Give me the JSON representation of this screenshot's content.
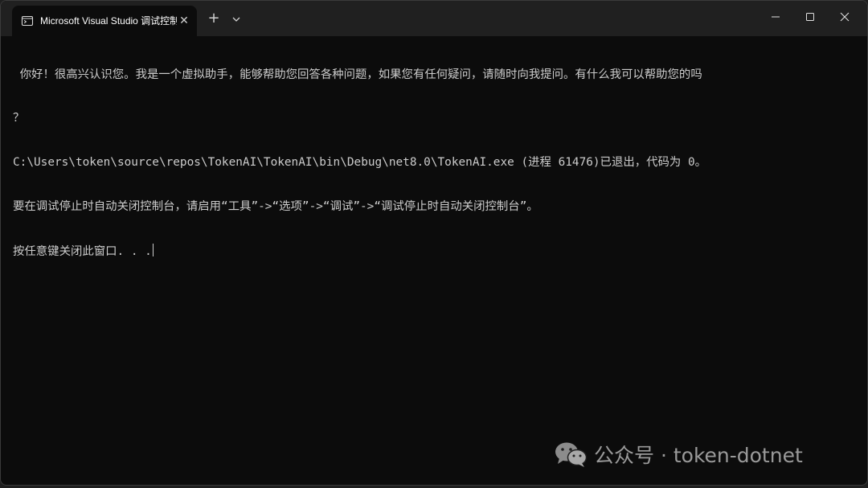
{
  "window": {
    "tab_title": "Microsoft Visual Studio 调试控制台",
    "tab_close": "✕",
    "new_tab": "+",
    "icons": {
      "tab": "terminal-icon",
      "dropdown": "chevron-down-icon",
      "minimize": "minimize-icon",
      "maximize": "maximize-icon",
      "close": "close-icon"
    }
  },
  "terminal": {
    "lines": [
      " 你好！很高兴认识您。我是一个虚拟助手，能够帮助您回答各种问题，如果您有任何疑问，请随时向我提问。有什么我可以帮助您的吗",
      "？",
      "C:\\Users\\token\\source\\repos\\TokenAI\\TokenAI\\bin\\Debug\\net8.0\\TokenAI.exe (进程 61476)已退出，代码为 0。",
      "要在调试停止时自动关闭控制台，请启用“工具”->“选项”->“调试”->“调试停止时自动关闭控制台”。",
      "按任意键关闭此窗口. . ."
    ]
  },
  "watermark": {
    "text": "公众号 · token-dotnet",
    "icon": "wechat-icon"
  },
  "colors": {
    "terminal_bg": "#0c0c0c",
    "titlebar_bg": "#202020",
    "text": "#cccccc"
  }
}
